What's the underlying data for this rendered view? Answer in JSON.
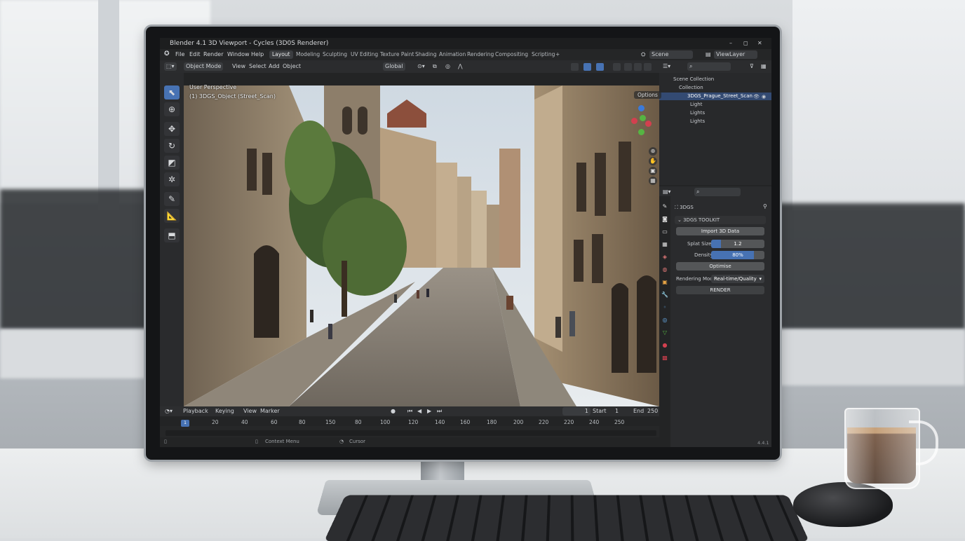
{
  "window": {
    "title": "Blender 4.1 3D Viewport - Cycles (3D0S Renderer)",
    "controls": [
      "–",
      "◻",
      "✕"
    ]
  },
  "menubar": {
    "items": [
      "File",
      "Edit",
      "Render",
      "Window",
      "Help"
    ],
    "workspaces": [
      "Layout",
      "Modeling",
      "Sculpting",
      "UV Editing",
      "Texture Paint",
      "Shading",
      "Animation",
      "Rendering",
      "Compositing",
      "Scripting",
      "+"
    ],
    "active_workspace": "Layout"
  },
  "header3d": {
    "mode": "Object Mode",
    "menus": [
      "View",
      "Select",
      "Add",
      "Object"
    ],
    "transform_orientation": "Global"
  },
  "scene": {
    "scene_name": "Scene",
    "view_layer": "ViewLayer",
    "search_placeholder": ""
  },
  "viewport": {
    "overlay_line1": "User Perspective",
    "overlay_line2": "(1) 3DGS_Object (Street_Scan)",
    "options_label": "Options"
  },
  "outliner": {
    "rows": [
      {
        "label": "Scene Collection",
        "selected": false
      },
      {
        "label": "Collection",
        "selected": false
      },
      {
        "label": "3DGS_Prague_Street_Scan",
        "selected": true
      },
      {
        "label": "Light",
        "selected": false
      },
      {
        "label": "Lights",
        "selected": false
      },
      {
        "label": "Lights",
        "selected": false
      }
    ]
  },
  "properties": {
    "object_name": "3DGS",
    "panel_title": "3DGS TOOLKIT",
    "import_button": "Import 3D Data",
    "splat_size_label": "Splat Size",
    "splat_size_value": "1.2",
    "splat_size_fraction": 0.18,
    "density_label": "Density",
    "density_value": "80%",
    "density_fraction": 0.8,
    "optimise_button": "Optimise",
    "rendering_mode_label": "Rendering Mode",
    "rendering_mode_value": "Real-time/Quality",
    "render_button": "RENDER",
    "version": "4.4.1"
  },
  "timeline": {
    "menus": [
      "Playback",
      "Keying",
      "View",
      "Marker"
    ],
    "current_frame": "1",
    "start_label": "Start",
    "start_value": "1",
    "end_label": "End",
    "end_value": "250",
    "top_numbers": [
      "100",
      "120",
      "140",
      "160",
      "180",
      "200",
      "220",
      "220",
      "240",
      "250"
    ],
    "ruler_numbers": [
      "20",
      "40",
      "60",
      "80",
      "150",
      "80",
      "100",
      "120",
      "140",
      "160",
      "180",
      "200",
      "220",
      "220",
      "240",
      "250"
    ],
    "playhead": "1"
  },
  "statusbar": {
    "left_hint": "Context Menu",
    "right_hint": "Cursor"
  },
  "colors": {
    "accent": "#4772b3",
    "panel_bg": "#2a2b2d",
    "header_bg": "#2b2c2e",
    "selected_row": "#334a72"
  }
}
